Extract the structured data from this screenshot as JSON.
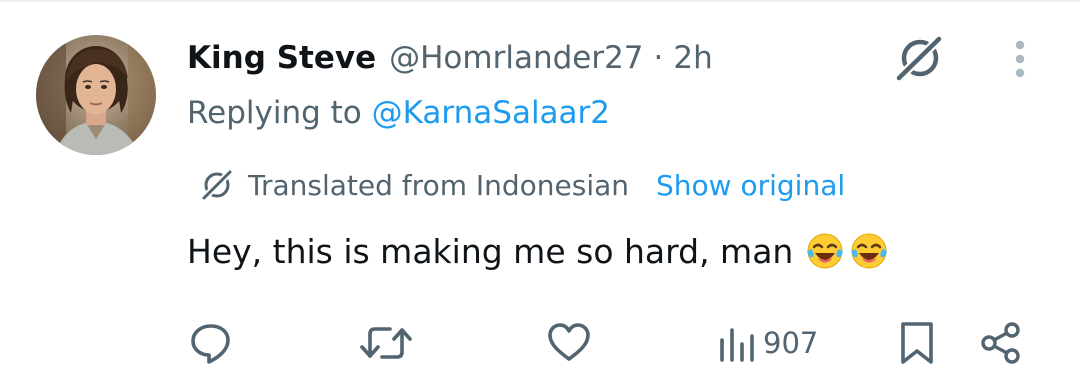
{
  "tweet": {
    "author": {
      "display_name": "King Steve",
      "handle": "@Homrlander27",
      "separator": "·",
      "time": "2h"
    },
    "replying_to": {
      "prefix": "Replying to",
      "mention": "@KarnaSalaar2"
    },
    "translation": {
      "label": "Translated from Indonesian",
      "show_original": "Show original",
      "icon": "translate-icon"
    },
    "text": "Hey, this is making me so hard, man",
    "emojis": [
      "face-with-tears-of-joy",
      "face-with-tears-of-joy"
    ]
  },
  "actions": {
    "reply_icon": "reply-icon",
    "retweet_icon": "retweet-icon",
    "like_icon": "heart-icon",
    "views_icon": "views-icon",
    "views_count": "907",
    "bookmark_icon": "bookmark-icon",
    "share_icon": "share-icon"
  },
  "colors": {
    "primary_text": "#0f1419",
    "secondary_text": "#536471",
    "accent": "#1d9bf0",
    "icon": "#536471"
  }
}
